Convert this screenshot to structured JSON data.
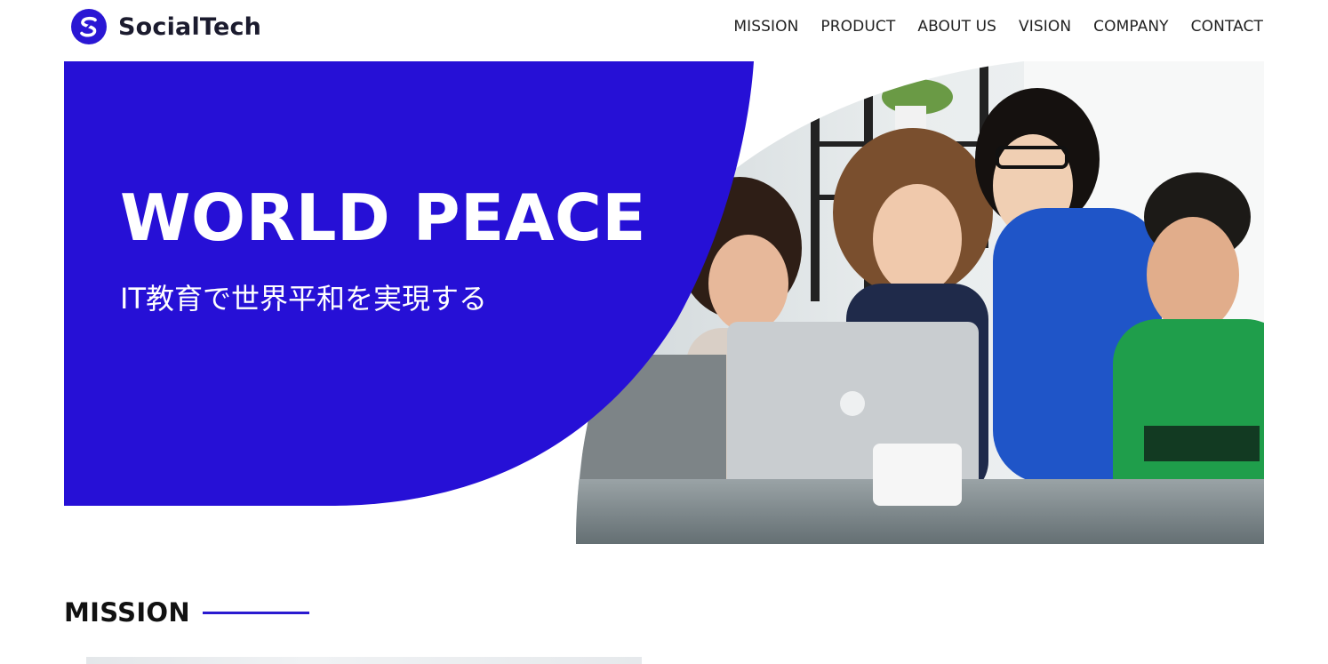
{
  "brand": {
    "name": "SocialTech",
    "logo_icon": "s-logo-icon",
    "accent": "#2610d6"
  },
  "nav": {
    "items": [
      "MISSION",
      "PRODUCT",
      "ABOUT US",
      "VISION",
      "COMPANY",
      "CONTACT"
    ]
  },
  "hero": {
    "title": "WORLD PEACE",
    "subtitle": "IT教育で世界平和を実現する",
    "photo_description": "people-around-laptop-photo"
  },
  "sections": {
    "mission": {
      "title": "MISSION"
    }
  }
}
